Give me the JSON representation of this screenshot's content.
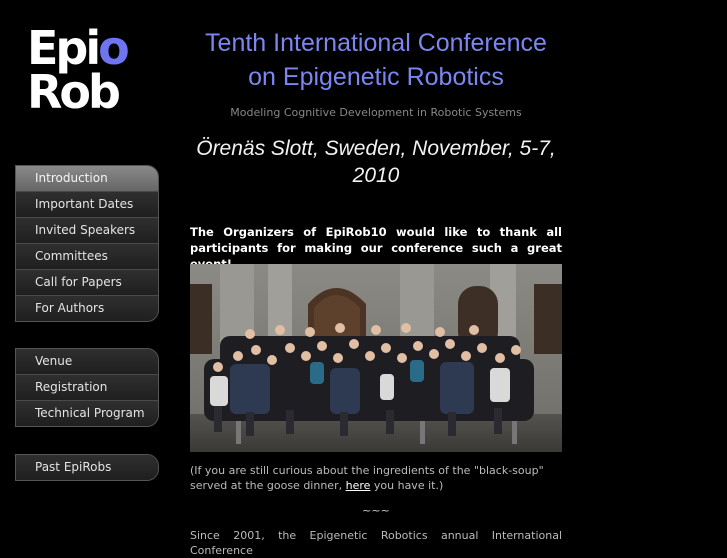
{
  "logo": {
    "line1_a": "Epi",
    "line1_b": "o",
    "line2": "Rob"
  },
  "nav": {
    "group1": [
      "Introduction",
      "Important Dates",
      "Invited Speakers",
      "Committees",
      "Call for Papers",
      "For Authors"
    ],
    "group2": [
      "Venue",
      "Registration",
      "Technical Program"
    ],
    "group3": [
      "Past EpiRobs"
    ],
    "active": "Introduction"
  },
  "header": {
    "title_line1": "Tenth International Conference",
    "title_line2": "on Epigenetic Robotics",
    "subtitle": "Modeling Cognitive Development in Robotic Systems",
    "venue_line1": "Örenäs Slott, Sweden, November, 5-7,",
    "venue_line2": "2010"
  },
  "content": {
    "thanks": "The Organizers of EpiRob10 would like to thank all participants for making our conference such a great event!",
    "note_before": "(If you are still curious about the ingredients of the \"black-soup\" served at the goose dinner, ",
    "note_link": "here",
    "note_after": " you have it.)",
    "separator": "~~~",
    "since": "Since 2001, the Epigenetic Robotics annual International Conference"
  },
  "colors": {
    "accent": "#7b86f0",
    "background": "#000000",
    "nav_active": "#7a7a7a"
  }
}
